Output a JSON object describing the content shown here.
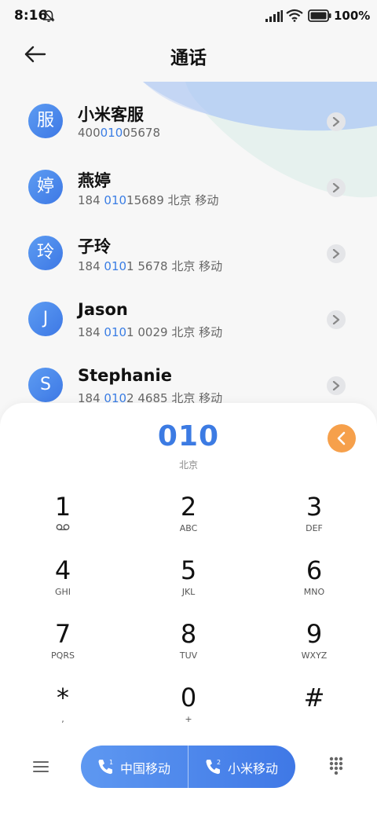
{
  "status": {
    "time": "8:16",
    "battery": "100%"
  },
  "header": {
    "title": "通话"
  },
  "contacts": [
    {
      "avatar": "服",
      "name": "小米客服",
      "pre": "400",
      "hl": "010",
      "post": "05678",
      "loc": ""
    },
    {
      "avatar": "婷",
      "name": "燕婷",
      "pre": "184 ",
      "hl": "010",
      "post": "15689",
      "loc": "北京 移动"
    },
    {
      "avatar": "玲",
      "name": "子玲",
      "pre": "184 ",
      "hl": "010",
      "post": "1 5678",
      "loc": "北京 移动"
    },
    {
      "avatar": "J",
      "name": "Jason",
      "pre": "184 ",
      "hl": "010",
      "post": "1 0029",
      "loc": "北京 移动"
    },
    {
      "avatar": "S",
      "name": "Stephanie",
      "pre": "184 ",
      "hl": "010",
      "post": "2 4685",
      "loc": "北京 移动"
    }
  ],
  "dialer": {
    "number": "010",
    "region": "北京",
    "keys": [
      {
        "digit": "1",
        "letters": ""
      },
      {
        "digit": "2",
        "letters": "ABC"
      },
      {
        "digit": "3",
        "letters": "DEF"
      },
      {
        "digit": "4",
        "letters": "GHI"
      },
      {
        "digit": "5",
        "letters": "JKL"
      },
      {
        "digit": "6",
        "letters": "MNO"
      },
      {
        "digit": "7",
        "letters": "PQRS"
      },
      {
        "digit": "8",
        "letters": "TUV"
      },
      {
        "digit": "9",
        "letters": "WXYZ"
      },
      {
        "digit": "*",
        "letters": ","
      },
      {
        "digit": "0",
        "letters": "+"
      },
      {
        "digit": "#",
        "letters": ""
      }
    ]
  },
  "calls": {
    "sim1": "中国移动",
    "sim2": "小米移动"
  },
  "colors": {
    "accent": "#3c7be3",
    "delete": "#f6a04b"
  },
  "icons": {
    "voicemail": "voicemail-icon",
    "back": "back-arrow-icon",
    "menu": "menu-icon",
    "keypad": "keypad-icon"
  }
}
